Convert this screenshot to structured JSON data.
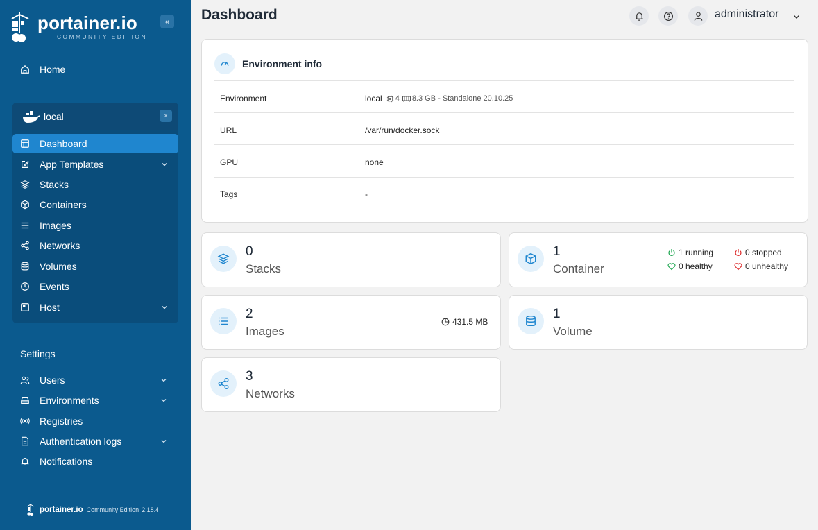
{
  "brand": {
    "name": "portainer.io",
    "edition_caps": "COMMUNITY EDITION",
    "collapse_glyph": "«"
  },
  "sidebar": {
    "home_label": "Home",
    "environment": {
      "name": "local",
      "close_glyph": "×",
      "items": [
        {
          "label": "Dashboard",
          "icon": "dashboard-icon",
          "active": true
        },
        {
          "label": "App Templates",
          "icon": "edit-icon",
          "expandable": true
        },
        {
          "label": "Stacks",
          "icon": "layers-icon"
        },
        {
          "label": "Containers",
          "icon": "box-icon"
        },
        {
          "label": "Images",
          "icon": "list-icon"
        },
        {
          "label": "Networks",
          "icon": "share-icon"
        },
        {
          "label": "Volumes",
          "icon": "database-icon"
        },
        {
          "label": "Events",
          "icon": "clock-icon"
        },
        {
          "label": "Host",
          "icon": "server-icon",
          "expandable": true
        }
      ]
    },
    "settings_label": "Settings",
    "settings_items": [
      {
        "label": "Users",
        "icon": "users-icon",
        "expandable": true
      },
      {
        "label": "Environments",
        "icon": "hdd-icon",
        "expandable": true
      },
      {
        "label": "Registries",
        "icon": "radio-icon"
      },
      {
        "label": "Authentication logs",
        "icon": "file-icon",
        "expandable": true
      },
      {
        "label": "Notifications",
        "icon": "bell-icon"
      }
    ],
    "footer": {
      "brand": "portainer.io",
      "edition": "Community Edition",
      "version": "2.18.4"
    }
  },
  "header": {
    "title": "Dashboard",
    "user": "administrator"
  },
  "env_info": {
    "title": "Environment info",
    "rows": [
      {
        "label": "Environment",
        "value": "local",
        "cpu": "4",
        "memory": "8.3 GB - Standalone 20.10.25"
      },
      {
        "label": "URL",
        "value": "/var/run/docker.sock"
      },
      {
        "label": "GPU",
        "value": "none"
      },
      {
        "label": "Tags",
        "value": "-"
      }
    ]
  },
  "stats": {
    "stacks": {
      "count": "0",
      "label": "Stacks"
    },
    "containers": {
      "count": "1",
      "label": "Container",
      "running": "1 running",
      "stopped": "0 stopped",
      "healthy": "0 healthy",
      "unhealthy": "0 unhealthy"
    },
    "images": {
      "count": "2",
      "label": "Images",
      "size": "431.5 MB"
    },
    "volumes": {
      "count": "1",
      "label": "Volume"
    },
    "networks": {
      "count": "3",
      "label": "Networks"
    }
  },
  "colors": {
    "sidebar": "#0b5a8e",
    "accent": "#1f86cf",
    "running": "#16a34a",
    "stopped": "#dc2626"
  }
}
